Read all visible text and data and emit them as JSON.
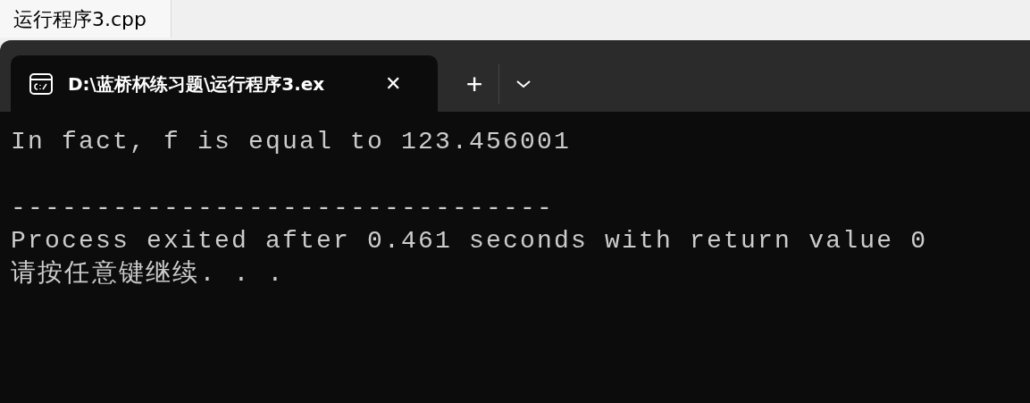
{
  "editor_tab": {
    "label": "运行程序3.cpp"
  },
  "terminal_tab": {
    "title": "D:\\蓝桥杯练习题\\运行程序3.ex",
    "close": "✕",
    "new_tab": "+"
  },
  "console_lines": [
    {
      "kind": "text",
      "text": "In fact, f is equal to 123.456001"
    },
    {
      "kind": "blank"
    },
    {
      "kind": "text",
      "text": "--------------------------------"
    },
    {
      "kind": "text",
      "text": "Process exited after 0.461 seconds with return value 0"
    },
    {
      "kind": "text",
      "text": "请按任意键继续. . ."
    }
  ]
}
